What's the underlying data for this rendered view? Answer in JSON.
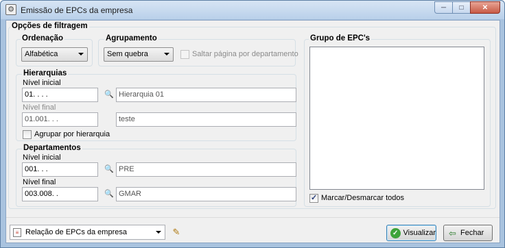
{
  "window": {
    "title": "Emissão de EPCs da empresa",
    "minimize_glyph": "─",
    "maximize_glyph": "□",
    "close_glyph": "✕"
  },
  "filters": {
    "title": "Opções de filtragem",
    "ordering": {
      "title": "Ordenação",
      "selected": "Alfabética"
    },
    "grouping": {
      "title": "Agrupamento",
      "selected": "Sem quebra",
      "skip_page_label": "Saltar página por departamento",
      "skip_page_checked": false
    },
    "hierarchies": {
      "title": "Hierarquias",
      "initial_label": "Nível inicial",
      "initial_code": "01.    .    .    .",
      "initial_name": "Hierarquia 01",
      "final_label": "Nível final",
      "final_code": "01.001.    .    .",
      "final_name": "teste",
      "group_by_label": "Agrupar por hierarquia",
      "group_by_checked": false
    },
    "departments": {
      "title": "Departamentos",
      "initial_label": "Nível inicial",
      "initial_code": "001.    .    .",
      "initial_name": "PRE",
      "final_label": "Nível final",
      "final_code": "003.008.    .",
      "final_name": "GMAR"
    },
    "epc_group": {
      "title": "Grupo de EPC's",
      "items": [],
      "toggle_all_label": "Marcar/Desmarcar todos",
      "toggle_all_checked": true
    }
  },
  "footer": {
    "report_selected": "Relação de EPCs da empresa",
    "preview_label": "Visualizar",
    "close_label": "Fechar"
  },
  "icons": {
    "app": "app-icon",
    "lookup": "magnifier-icon",
    "report": "report-icon",
    "edit": "edit-icon",
    "preview": "check-circle-icon",
    "close": "exit-icon"
  }
}
